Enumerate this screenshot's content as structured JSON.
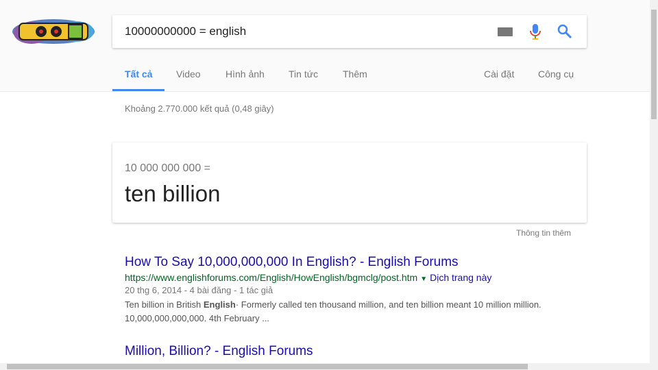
{
  "search": {
    "query": "10000000000 = english"
  },
  "tabs": [
    {
      "label": "Tất cả"
    },
    {
      "label": "Video"
    },
    {
      "label": "Hình ảnh"
    },
    {
      "label": "Tin tức"
    },
    {
      "label": "Thêm"
    }
  ],
  "tools": {
    "settings": "Cài đặt",
    "tools": "Công cụ"
  },
  "stats": "Khoảng 2.770.000 kết quả (0,48 giây)",
  "answer": {
    "equation": "10 000 000 000 =",
    "result": "ten billion",
    "more_info": "Thông tin thêm"
  },
  "results": [
    {
      "title": "How To Say 10,000,000,000 In English? - English Forums",
      "url": "https://www.englishforums.com/English/HowEnglish/bgmclg/post.htm",
      "translate": "Dịch trang này",
      "meta": "20 thg 6, 2014 - 4 bài đăng - 1 tác giả",
      "snippet_pre": "Ten billion in British ",
      "snippet_bold": "English",
      "snippet_post": "· Formerly called ten thousand million, and ten billion meant 10 million million. 10,000,000,000,000. 4th February ..."
    },
    {
      "title": "Million, Billion? - English Forums"
    }
  ],
  "colors": {
    "accent": "#4285f4",
    "link": "#1a0dab",
    "url": "#006621"
  }
}
